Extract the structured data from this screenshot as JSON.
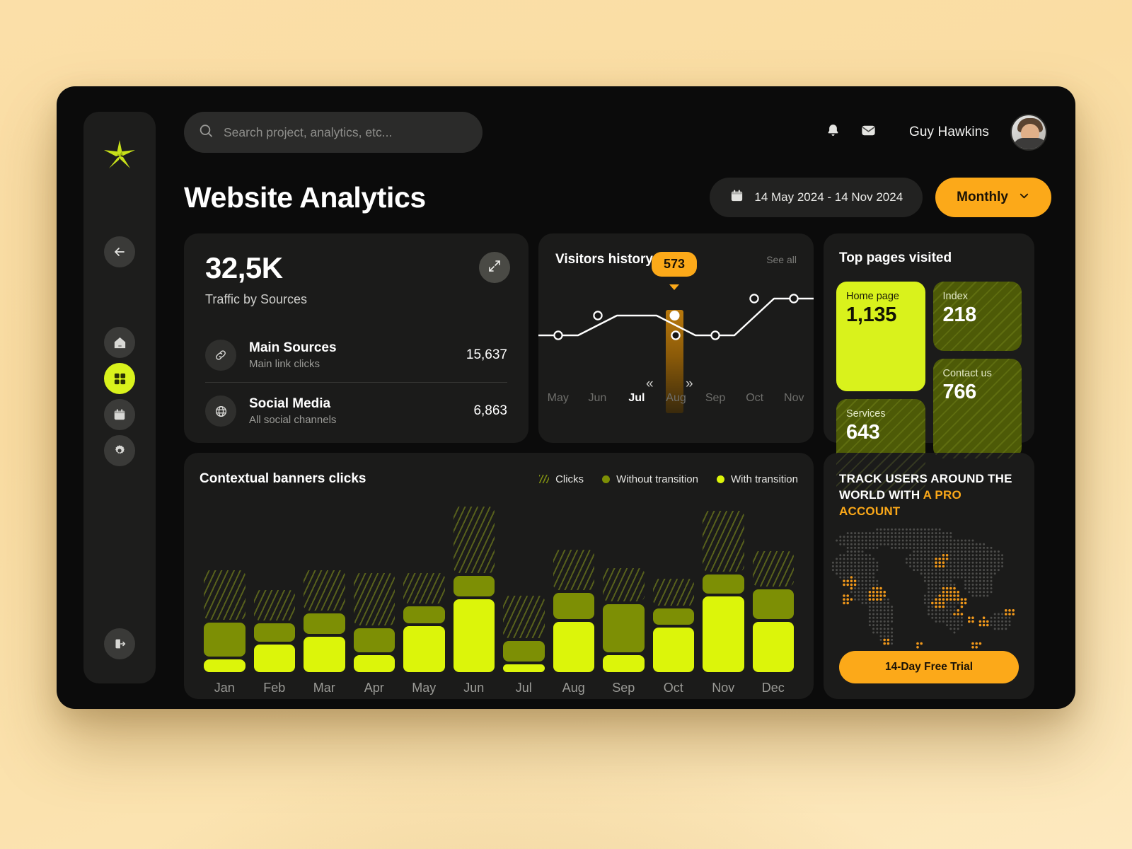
{
  "search": {
    "placeholder": "Search project, analytics, etc..."
  },
  "header": {
    "username": "Guy Hawkins",
    "bell_icon": "bell-icon",
    "mail_icon": "mail-icon"
  },
  "page": {
    "title": "Website Analytics"
  },
  "controls": {
    "date_range": "14 May 2024 - 14 Nov 2024",
    "period": "Monthly"
  },
  "sidebar": {
    "logo": "asterisk-logo",
    "items": [
      {
        "name": "back",
        "icon": "arrow-left-icon",
        "active": false
      },
      {
        "name": "home",
        "icon": "home-icon",
        "active": false
      },
      {
        "name": "dashboard",
        "icon": "grid-icon",
        "active": true
      },
      {
        "name": "calendar",
        "icon": "calendar-icon",
        "active": false
      },
      {
        "name": "settings",
        "icon": "gear-icon",
        "active": false
      },
      {
        "name": "logout",
        "icon": "logout-icon",
        "active": false
      }
    ]
  },
  "traffic": {
    "value": "32,5K",
    "label": "Traffic by Sources",
    "expand_icon": "expand-icon",
    "rows": [
      {
        "icon": "link-icon",
        "name": "Main Sources",
        "desc": "Main link clicks",
        "value": "15,637"
      },
      {
        "icon": "globe-icon",
        "name": "Social Media",
        "desc": "All social channels",
        "value": "6,863"
      }
    ]
  },
  "visitors": {
    "title": "Visitors history",
    "see_all": "See all",
    "tooltip_value": "573",
    "prev_icon": "«",
    "next_icon": "»",
    "selected_month": "Jul"
  },
  "top_pages": {
    "title": "Top pages visited",
    "tiles": [
      {
        "label": "Home page",
        "value": "1,135",
        "style": "bright"
      },
      {
        "label": "Index",
        "value": "218",
        "style": "dim"
      },
      {
        "label": "Contact us",
        "value": "766",
        "style": "dim"
      },
      {
        "label": "Services",
        "value": "643",
        "style": "dim"
      }
    ]
  },
  "banners": {
    "title": "Contextual banners clicks",
    "legend": [
      {
        "label": "Clicks",
        "swatch": "stripes"
      },
      {
        "label": "Without transition",
        "swatch": "#7d8f05"
      },
      {
        "label": "With transition",
        "swatch": "#dcf50a"
      }
    ]
  },
  "promo": {
    "line1": "TRACK USERS AROUND THE",
    "line2_plain": "WORLD WITH ",
    "line2_hl": "A PRO ACCOUNT",
    "cta": "14-Day Free Trial"
  },
  "colors": {
    "accent_yellow": "#d9f21c",
    "accent_olive": "#7d8f05",
    "accent_orange": "#fca919",
    "panel": "#1b1b1a",
    "window": "#0b0b0b",
    "page_bg": "#fbdfa8"
  },
  "chart_data": [
    {
      "type": "line",
      "title": "Visitors history",
      "x": [
        "May",
        "Jun",
        "Jul",
        "Aug",
        "Sep",
        "Oct",
        "Nov"
      ],
      "values": [
        410,
        545,
        573,
        340,
        338,
        640,
        638
      ],
      "ylabel": "",
      "xlabel": "",
      "annotations": [
        {
          "x": "Jul",
          "value": 573,
          "label": "573",
          "highlight": true
        }
      ],
      "grid": false,
      "legend": "none"
    },
    {
      "type": "bar",
      "title": "Contextual banners clicks",
      "categories": [
        "Jan",
        "Feb",
        "Mar",
        "Apr",
        "May",
        "Jun",
        "Jul",
        "Aug",
        "Sep",
        "Oct",
        "Nov",
        "Dec"
      ],
      "stacked": true,
      "series": [
        {
          "name": "With transition",
          "color": "#dcf50a",
          "values": [
            22,
            48,
            62,
            30,
            80,
            128,
            14,
            88,
            30,
            78,
            132,
            88
          ]
        },
        {
          "name": "Without transition",
          "color": "#7d8f05",
          "values": [
            60,
            32,
            36,
            42,
            30,
            36,
            36,
            46,
            84,
            28,
            34,
            52
          ]
        },
        {
          "name": "Clicks",
          "color": "striped",
          "values": [
            86,
            54,
            70,
            92,
            54,
            116,
            74,
            70,
            58,
            48,
            106,
            62
          ]
        }
      ],
      "ylabel": "",
      "xlabel": "",
      "grid": false,
      "legend": "top-right"
    }
  ]
}
